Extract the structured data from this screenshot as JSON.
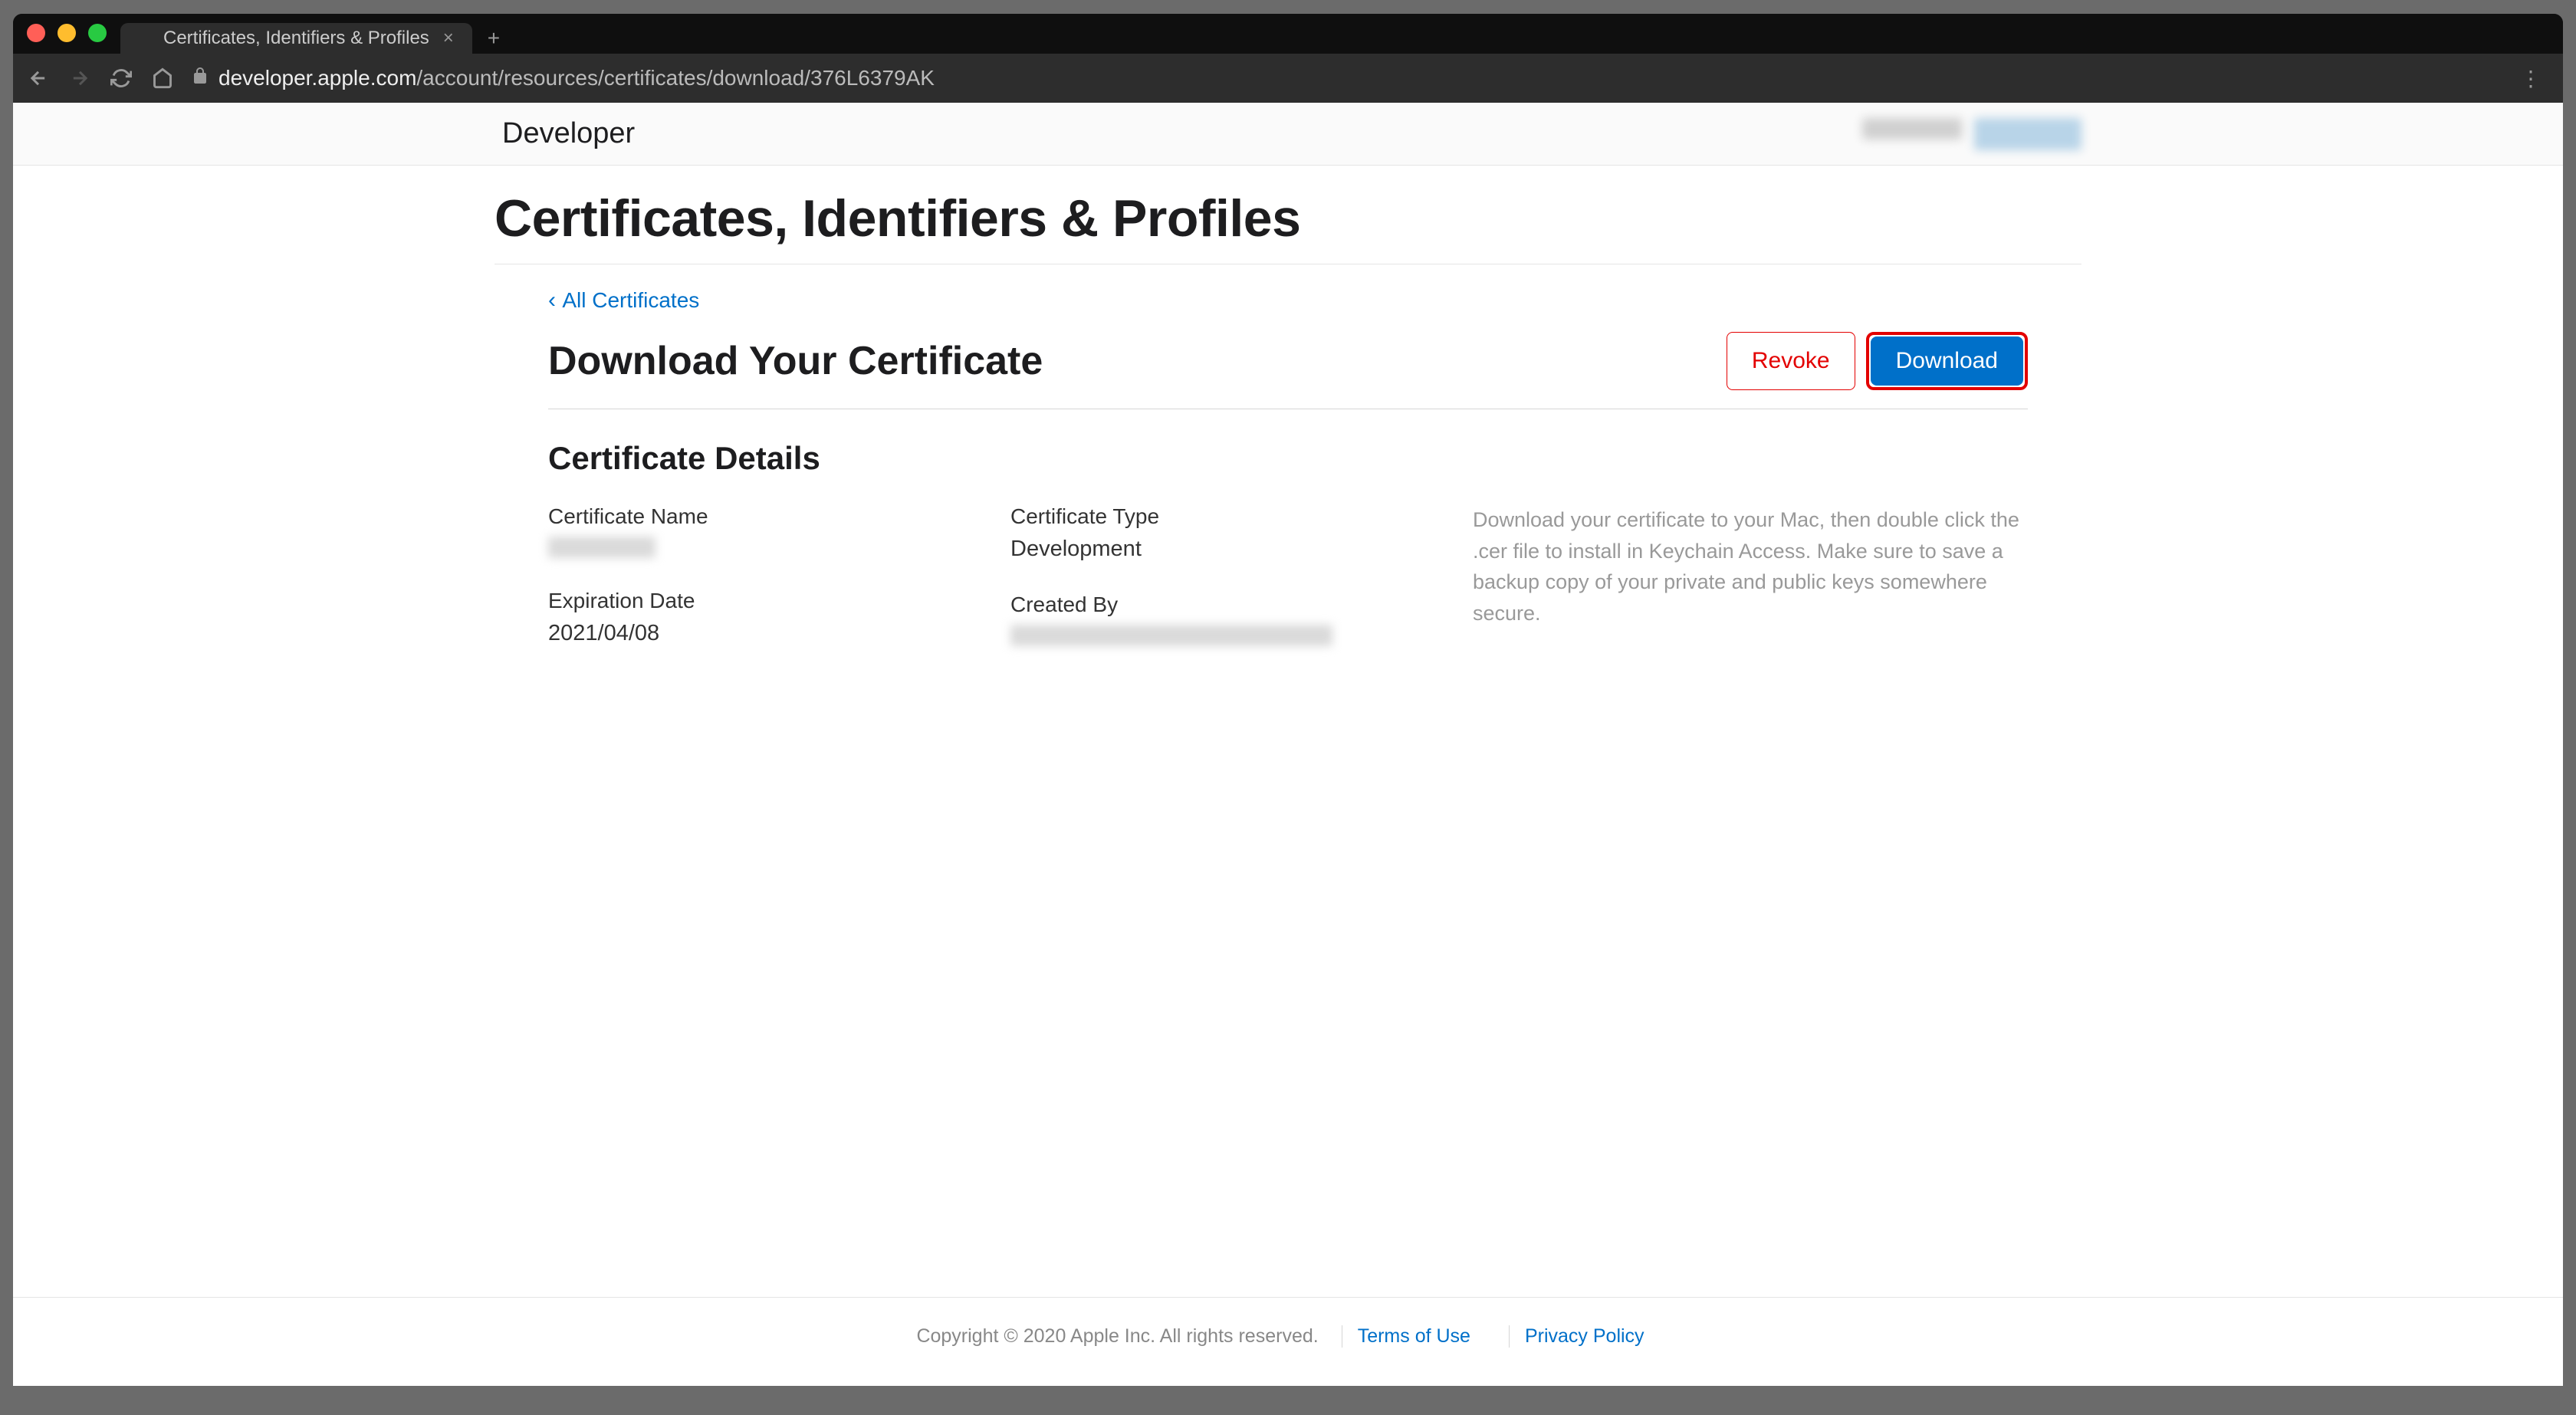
{
  "browser": {
    "tab_title": "Certificates, Identifiers & Profiles",
    "url_domain": "developer.apple.com",
    "url_path": "/account/resources/certificates/download/376L6379AK"
  },
  "header": {
    "brand": "Developer"
  },
  "page": {
    "title": "Certificates, Identifiers & Profiles",
    "breadcrumb": "All Certificates",
    "section_title": "Download Your Certificate",
    "revoke_label": "Revoke",
    "download_label": "Download",
    "details_title": "Certificate Details",
    "fields": {
      "cert_name_label": "Certificate Name",
      "cert_type_label": "Certificate Type",
      "cert_type_value": "Development",
      "expiration_label": "Expiration Date",
      "expiration_value": "2021/04/08",
      "created_by_label": "Created By"
    },
    "help_text": "Download your certificate to your Mac, then double click the .cer file to install in Keychain Access. Make sure to save a backup copy of your private and public keys somewhere secure."
  },
  "footer": {
    "copyright": "Copyright © 2020 Apple Inc. All rights reserved.",
    "terms": "Terms of Use",
    "privacy": "Privacy Policy"
  }
}
